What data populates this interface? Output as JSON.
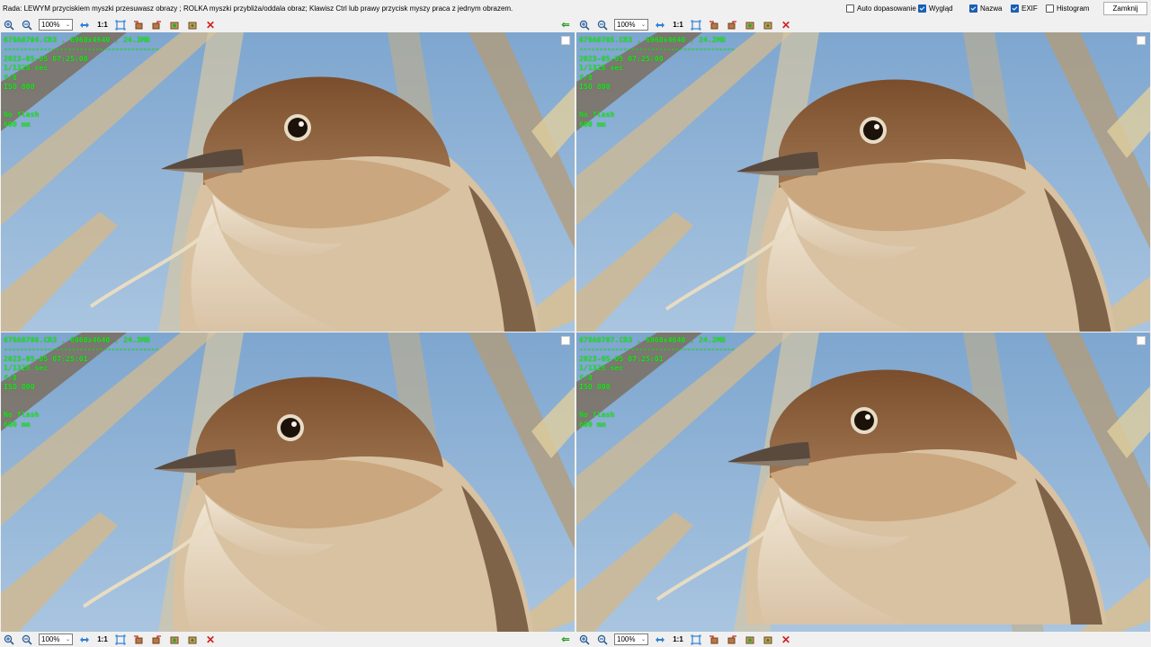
{
  "hint": "Rada: LEWYM przyciskiem myszki przesuwasz obrazy ; ROLKA myszki przybliża/oddala obraz; Klawisz Ctrl lub prawy przycisk myszy praca z jednym obrazem.",
  "options": {
    "auto_fit": {
      "label": "Auto dopasowanie",
      "checked": false
    },
    "appearance": {
      "label": "Wygląd",
      "checked": true
    },
    "name": {
      "label": "Nazwa",
      "checked": true
    },
    "exif": {
      "label": "EXIF",
      "checked": true
    },
    "histogram": {
      "label": "Histogram",
      "checked": false
    }
  },
  "close_label": "Zamknij",
  "toolbar": {
    "zoom_value": "100%",
    "ratio_label": "1:1",
    "icons": [
      "zoom-in-icon",
      "zoom-out-icon",
      "fit-arrows-icon",
      "fit-screen-icon",
      "rotate-left-icon",
      "rotate-right-icon",
      "flip-icon",
      "compare-icon",
      "delete-icon"
    ]
  },
  "panels": [
    {
      "file": "679A0704.CR3",
      "dims": "6960x4640",
      "size": "24.3MB",
      "separator": "---------------------------------------",
      "datetime": "2023-05-05 07:25:00",
      "shutter": "1/1328 sec",
      "aperture": "f/8",
      "iso": "ISO 800",
      "flash": "No flash",
      "focal": "600 mm"
    },
    {
      "file": "679A0705.CR3",
      "dims": "6960x4640",
      "size": "24.2MB",
      "separator": "---------------------------------------",
      "datetime": "2023-05-05 07:25:00",
      "shutter": "1/1328 sec",
      "aperture": "f/8",
      "iso": "ISO 800",
      "flash": "No flash",
      "focal": "600 mm"
    },
    {
      "file": "679A0706.CR3",
      "dims": "6960x4640",
      "size": "24.3MB",
      "separator": "---------------------------------------",
      "datetime": "2023-05-05 07:25:01",
      "shutter": "1/1328 sec",
      "aperture": "f/8",
      "iso": "ISO 800",
      "flash": "No flash",
      "focal": "600 mm"
    },
    {
      "file": "679A0707.CR3",
      "dims": "6960x4640",
      "size": "24.2MB",
      "separator": "---------------------------------------",
      "datetime": "2023-05-05 07:25:01",
      "shutter": "1/1328 sec",
      "aperture": "f/8",
      "iso": "ISO 800",
      "flash": "No flash",
      "focal": "600 mm"
    }
  ],
  "colors": {
    "overlay_text": "#19e619",
    "sky": "#8fb3d6",
    "reed": "#d8c9a8",
    "bird_head": "#8a5e38",
    "bird_throat": "#efe6d6"
  }
}
